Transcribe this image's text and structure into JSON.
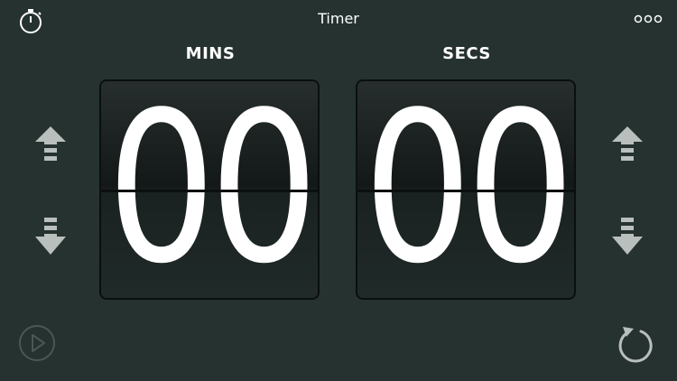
{
  "header": {
    "title": "Timer",
    "stopwatch_icon": "stopwatch-icon",
    "more_icon": "more-options-icon"
  },
  "minutes": {
    "label": "MINS",
    "value": "00"
  },
  "seconds": {
    "label": "SECS",
    "value": "00"
  },
  "controls": {
    "increment_icon": "arrow-up-icon",
    "decrement_icon": "arrow-down-icon",
    "play_icon": "play-icon",
    "reset_icon": "reset-icon"
  },
  "colors": {
    "background": "#25322f",
    "arrow": "#b9bfbd",
    "text": "#ffffff",
    "disabled": "#4a5755"
  }
}
